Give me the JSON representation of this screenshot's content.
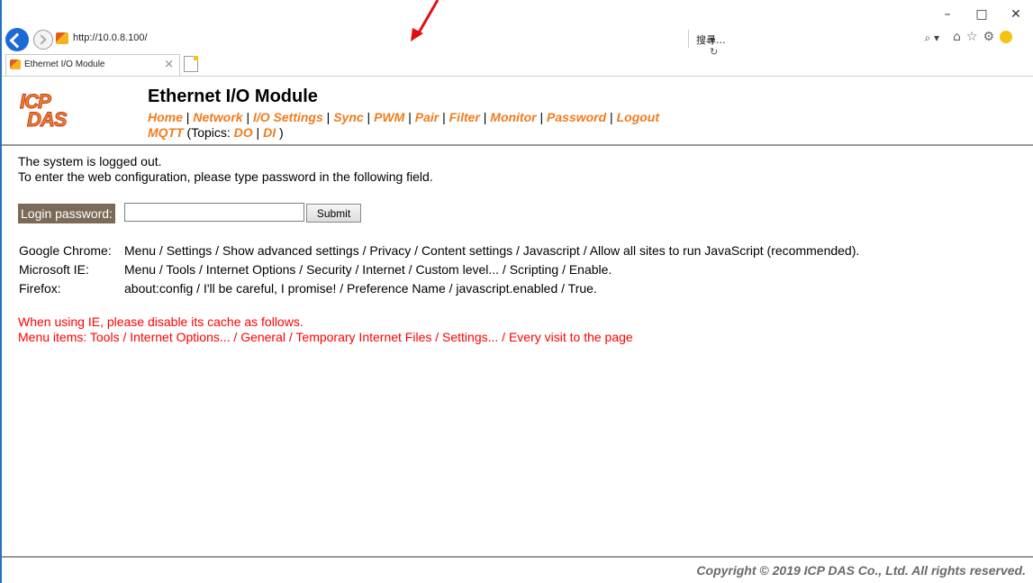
{
  "browser": {
    "url": "http://10.0.8.100/",
    "refresh_glyph": "▾ ↻",
    "search_placeholder": "搜尋...",
    "search_glyph": "⌕ ▾",
    "tab_title": "Ethernet I/O Module",
    "tab_close": "×",
    "caption": {
      "minimize": "–",
      "maximize": "□",
      "close": "✕"
    },
    "toolbar": {
      "home": "⌂",
      "favorites": "☆",
      "settings": "⚙"
    }
  },
  "header": {
    "logo_line1": "ICP",
    "logo_line2": "DAS",
    "title": "Ethernet I/O Module",
    "nav": [
      "Home",
      "Network",
      "I/O Settings",
      "Sync",
      "PWM",
      "Pair",
      "Filter",
      "Monitor",
      "Password",
      "Logout"
    ],
    "mqtt": "MQTT",
    "topics_prefix": "(Topics:",
    "topic_do": "DO",
    "topic_di": "DI",
    "topics_suffix": ")"
  },
  "content": {
    "logged_out": "The system is logged out.",
    "instruction": "To enter the web configuration, please type password in the following field.",
    "login_label": "Login password:",
    "password_value": "",
    "submit_label": "Submit",
    "browsers": [
      {
        "name": "Google Chrome:",
        "path": "Menu / Settings / Show advanced settings / Privacy / Content settings / Javascript / Allow all sites to run JavaScript (recommended)."
      },
      {
        "name": "Microsoft IE:",
        "path": "Menu / Tools / Internet Options / Security / Internet / Custom level... / Scripting / Enable."
      },
      {
        "name": "Firefox:",
        "path": "about:config / I'll be careful, I promise! / Preference Name / javascript.enabled / True."
      }
    ],
    "ie_warning": "When using IE, please disable its cache as follows.",
    "ie_menu": "Menu items: Tools / Internet Options... / General / Temporary Internet Files / Settings... / Every visit to the page"
  },
  "footer": {
    "copyright": "Copyright © 2019 ICP DAS Co., Ltd. All rights reserved."
  },
  "colors": {
    "nav_link": "#f07c1c",
    "warning": "#ff0000",
    "login_label_bg": "#7b6a57",
    "annotation_arrow": "#e0100f"
  }
}
